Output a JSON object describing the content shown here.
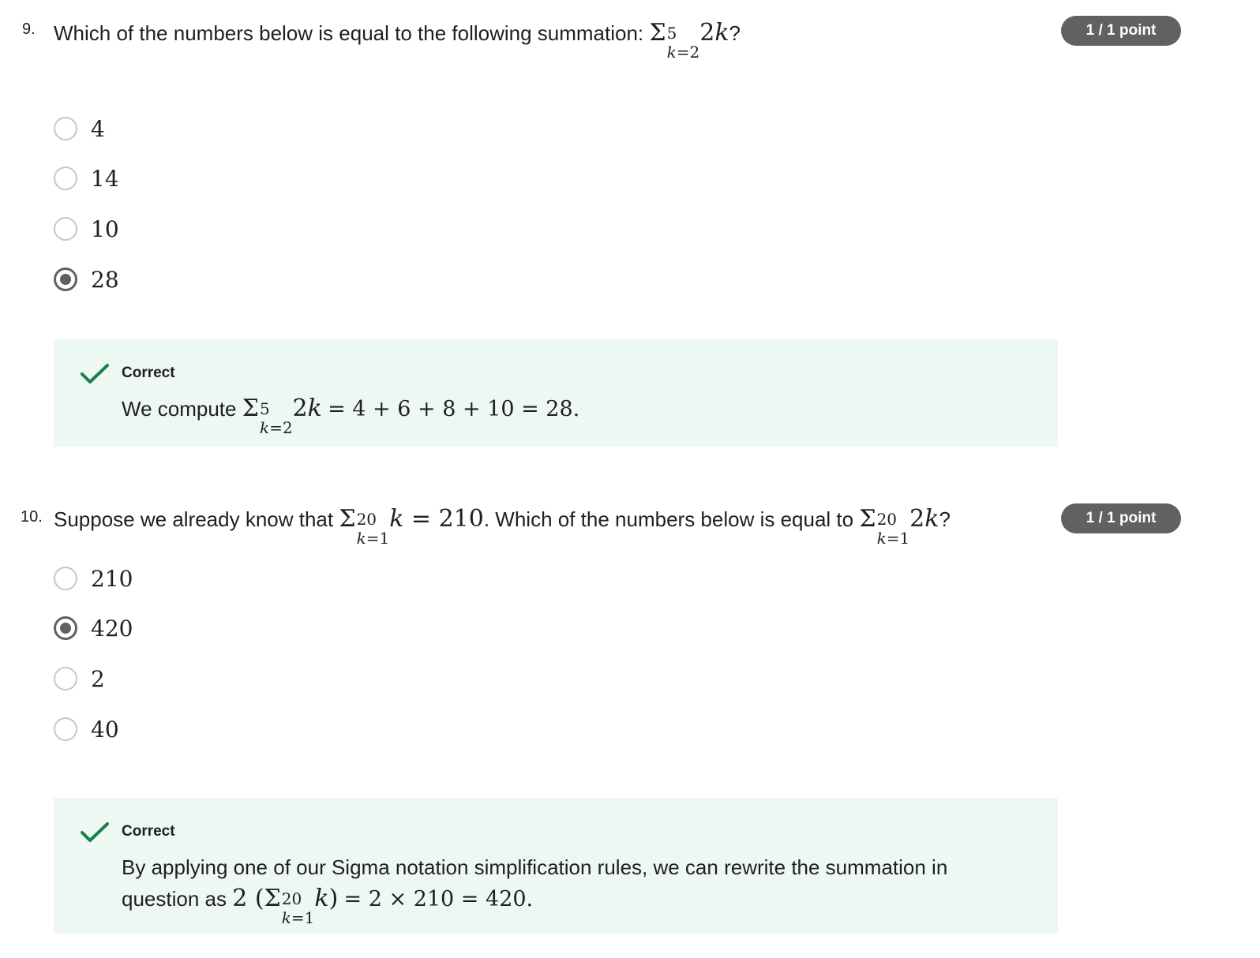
{
  "questions": [
    {
      "number": "9.",
      "prompt_prefix": "Which of the numbers below is equal to the following summation:",
      "points": "1 / 1 point",
      "options": [
        "4",
        "14",
        "10",
        "28"
      ],
      "selected_option": "28",
      "feedback": {
        "title": "Correct",
        "text_prefix": "We compute",
        "text_suffix": "= 4 + 6 + 8 + 10 = 28."
      }
    },
    {
      "number": "10.",
      "prompt_prefix": "Suppose we already know that",
      "prompt_mid": "= 210",
      "prompt_middle_text": ". Which of the numbers below is equal to",
      "points": "1 / 1 point",
      "options": [
        "210",
        "420",
        "2",
        "40"
      ],
      "selected_option": "420",
      "feedback": {
        "title": "Correct",
        "text": "By applying one of our Sigma notation simplification rules, we can rewrite the summation in question as",
        "text_suffix": "= 2 × 210 = 420."
      }
    }
  ],
  "icons": {
    "check": "checkmark-icon",
    "radio": "radio-button-icon"
  },
  "colors": {
    "badge_bg": "#616161",
    "feedback_bg": "#eef8f3",
    "check": "#1a7f4b"
  }
}
